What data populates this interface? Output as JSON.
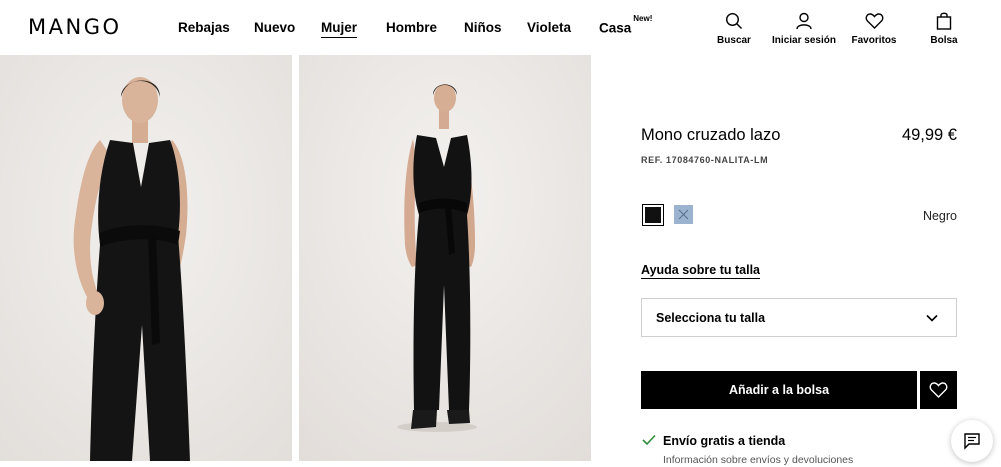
{
  "brand": {
    "logo": "MANGO"
  },
  "nav": [
    {
      "label": "Rebajas"
    },
    {
      "label": "Nuevo"
    },
    {
      "label": "Mujer"
    },
    {
      "label": "Hombre"
    },
    {
      "label": "Niños"
    },
    {
      "label": "Violeta"
    },
    {
      "label": "Casa",
      "badge": "New!"
    }
  ],
  "header_actions": {
    "search": "Buscar",
    "login": "Iniciar sesión",
    "favorites": "Favoritos",
    "bag": "Bolsa"
  },
  "product": {
    "name": "Mono cruzado lazo",
    "price": "49,99 €",
    "reference": "REF. 17084760-NALITA-LM",
    "selected_color": "Negro",
    "colors": [
      {
        "name": "black",
        "hex": "#111111"
      },
      {
        "name": "light-blue",
        "hex": "#9bb3cf"
      }
    ]
  },
  "size": {
    "help_link": "Ayuda sobre tu talla",
    "select_label": "Selecciona tu talla"
  },
  "actions": {
    "add_to_bag": "Añadir a la bolsa"
  },
  "shipping": {
    "title": "Envío gratis a tienda",
    "info": "Información sobre envíos y devoluciones"
  },
  "icons": {
    "search": "search-icon",
    "user": "user-icon",
    "heart": "heart-icon",
    "bag": "bag-icon",
    "chevron": "chevron-down-icon",
    "check": "check-icon",
    "chat": "chat-icon"
  }
}
